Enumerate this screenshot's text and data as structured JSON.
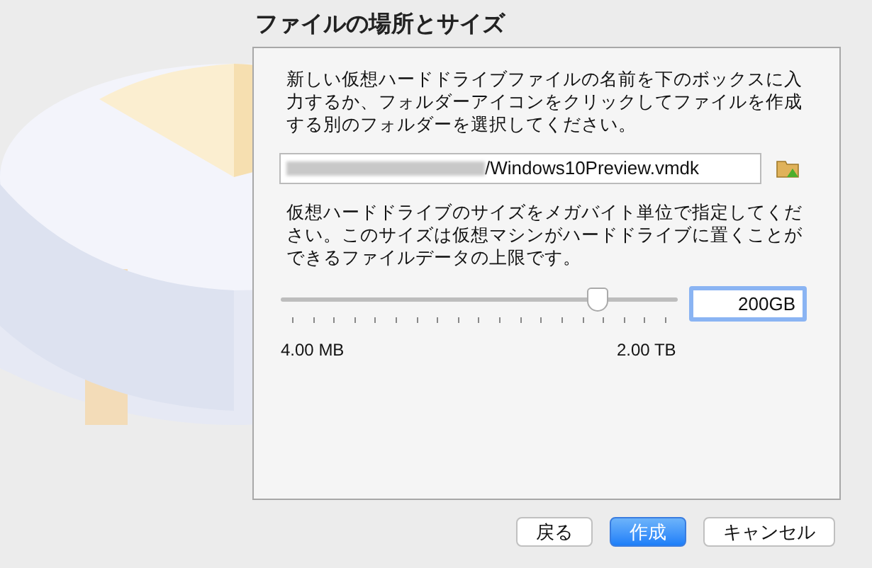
{
  "title": "ファイルの場所とサイズ",
  "location": {
    "description": "新しい仮想ハードドライブファイルの名前を下のボックスに入力するか、フォルダーアイコンをクリックしてファイルを作成する別のフォルダーを選択してください。",
    "value": "/Windows10Preview.vmdk"
  },
  "size": {
    "description": "仮想ハードドライブのサイズをメガバイト単位で指定してください。このサイズは仮想マシンがハードドライブに置くことができるファイルデータの上限です。",
    "level": 0.8,
    "value": "200GB",
    "min_label": "4.00 MB",
    "max_label": "2.00 TB"
  },
  "buttons": [
    {
      "label": "戻る",
      "kind": "normal"
    },
    {
      "label": "作成",
      "kind": "default"
    },
    {
      "label": "キャンセル",
      "kind": "normal"
    }
  ]
}
